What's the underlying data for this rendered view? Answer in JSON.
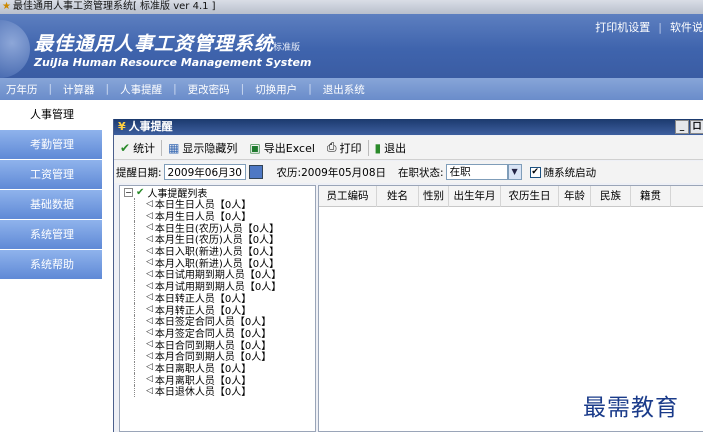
{
  "window": {
    "title": "最佳通用人事工资管理系统[ 标准版 ver 4.1 ]"
  },
  "banner": {
    "title": "最佳通用人事工资管理系统",
    "edition": "标准版",
    "subtitle": "ZuiJia Human Resource Management System",
    "links": [
      "打印机设置",
      "软件说"
    ]
  },
  "menubar": {
    "items": [
      "万年历",
      "计算器",
      "人事提醒",
      "更改密码",
      "切换用户",
      "退出系统"
    ]
  },
  "leftnav": {
    "items": [
      "人事管理",
      "考勤管理",
      "工资管理",
      "基础数据",
      "系统管理",
      "系统帮助"
    ]
  },
  "inner": {
    "title": "人事提醒",
    "window_buttons": [
      "_",
      "口"
    ],
    "toolbar": [
      "统计",
      "显示隐藏列",
      "导出Excel",
      "打印",
      "退出"
    ],
    "filter": {
      "date_label": "提醒日期:",
      "date_value": "2009年06月30日",
      "lunar_label": "农历:",
      "lunar_value": "2009年05月08日",
      "status_label": "在职状态:",
      "status_value": "在职",
      "auto_start_label": "随系统启动",
      "auto_start_checked": true
    },
    "tree": {
      "root": "人事提醒列表",
      "items": [
        "本日生日人员【0人】",
        "本月生日人员【0人】",
        "本日生日(农历)人员【0人】",
        "本月生日(农历)人员【0人】",
        "本日入职(新进)人员【0人】",
        "本月入职(新进)人员【0人】",
        "本日试用期到期人员【0人】",
        "本月试用期到期人员【0人】",
        "本日转正人员【0人】",
        "本月转正人员【0人】",
        "本日签定合同人员【0人】",
        "本月签定合同人员【0人】",
        "本日合同到期人员【0人】",
        "本月合同到期人员【0人】",
        "本日离职人员【0人】",
        "本月离职人员【0人】",
        "本日退休人员【0人】"
      ]
    },
    "grid": {
      "columns": [
        "员工编码",
        "姓名",
        "性别",
        "出生年月",
        "农历生日",
        "年龄",
        "民族",
        "籍贯"
      ]
    }
  },
  "watermark": "最需教育"
}
